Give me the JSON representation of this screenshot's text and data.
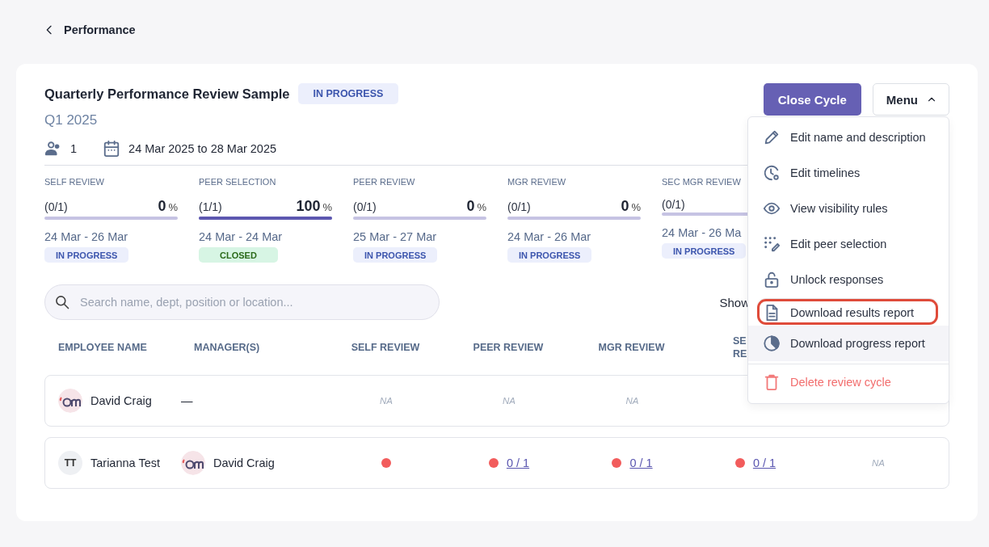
{
  "back": {
    "label": "Performance"
  },
  "cycle": {
    "title": "Quarterly Performance Review Sample",
    "status": {
      "label": "IN PROGRESS",
      "kind": "progress"
    },
    "period": "Q1 2025",
    "participants": "1",
    "dates": "24 Mar 2025 to 28 Mar 2025"
  },
  "actions": {
    "close": "Close Cycle",
    "menu": {
      "label": "Menu",
      "expanded": true
    }
  },
  "stages": [
    {
      "name": "SELF REVIEW",
      "count": "(0/1)",
      "percent": "0",
      "unit": "%",
      "level": 0,
      "dates": "24 Mar - 26 Mar",
      "status": {
        "label": "IN PROGRESS",
        "kind": "progress"
      }
    },
    {
      "name": "PEER SELECTION",
      "count": "(1/1)",
      "percent": "100",
      "unit": "%",
      "level": 1,
      "dates": "24 Mar - 24 Mar",
      "status": {
        "label": "CLOSED",
        "kind": "closed"
      }
    },
    {
      "name": "PEER REVIEW",
      "count": "(0/1)",
      "percent": "0",
      "unit": "%",
      "level": 0,
      "dates": "25 Mar - 27 Mar",
      "status": {
        "label": "IN PROGRESS",
        "kind": "progress"
      }
    },
    {
      "name": "MGR REVIEW",
      "count": "(0/1)",
      "percent": "0",
      "unit": "%",
      "level": 0,
      "dates": "24 Mar - 26 Mar",
      "status": {
        "label": "IN PROGRESS",
        "kind": "progress"
      }
    },
    {
      "name": "SEC MGR REVIEW",
      "count": "(0/1)",
      "level": 0,
      "dates": "24 Mar - 26 Ma",
      "status": {
        "label": "IN PROGRESS",
        "kind": "progress"
      }
    }
  ],
  "search": {
    "placeholder": "Search name, dept, position or location..."
  },
  "show_label": "Show",
  "table": {
    "columns": [
      "EMPLOYEE NAME",
      "MANAGER(S)",
      "SELF REVIEW",
      "PEER REVIEW",
      "MGR REVIEW",
      "SE RE"
    ],
    "rows": [
      {
        "cells": [
          {
            "kind": "person",
            "text": "David Craig"
          },
          {
            "kind": "text",
            "text": "—"
          },
          {
            "kind": "na",
            "text": "NA"
          },
          {
            "kind": "na",
            "text": "NA"
          },
          {
            "kind": "na",
            "text": "NA"
          }
        ]
      },
      {
        "cells": [
          {
            "kind": "person",
            "initials": "TT",
            "text": "Tarianna Test"
          },
          {
            "kind": "person",
            "text": "David Craig"
          },
          {
            "kind": "dot",
            "color": "#f25c5c"
          },
          {
            "kind": "dot",
            "color": "#f25c5c",
            "link": "0 / 1"
          },
          {
            "kind": "dot",
            "color": "#f25c5c",
            "link": "0 / 1"
          },
          {
            "kind": "dot",
            "color": "#f25c5c",
            "link": "0 / 1"
          },
          {
            "kind": "na",
            "text": "NA"
          }
        ]
      }
    ]
  },
  "menu_items": [
    {
      "label": "Edit name and description",
      "kind": "normal",
      "hovered": false,
      "outlined": false
    },
    {
      "label": "Edit timelines",
      "kind": "normal",
      "hovered": false,
      "outlined": false
    },
    {
      "label": "View visibility rules",
      "kind": "normal",
      "hovered": false,
      "outlined": false
    },
    {
      "label": "Edit peer selection",
      "kind": "normal",
      "hovered": false,
      "outlined": false
    },
    {
      "label": "Unlock responses",
      "kind": "normal",
      "hovered": false,
      "outlined": false
    },
    {
      "label": "Download results report",
      "kind": "normal",
      "hovered": false,
      "outlined": true
    },
    {
      "label": "Download progress report",
      "kind": "normal",
      "hovered": true,
      "outlined": false
    },
    {
      "label": "Delete review cycle",
      "kind": "danger",
      "hovered": false,
      "outlined": false
    }
  ]
}
